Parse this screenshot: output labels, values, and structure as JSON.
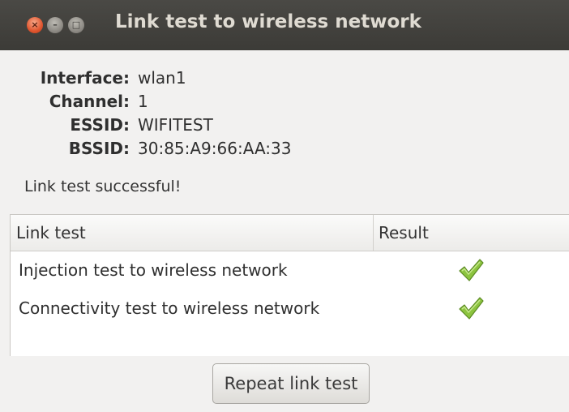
{
  "window": {
    "title": "Link test to wireless network",
    "buttons": {
      "close": "×",
      "minimize": "–",
      "maximize": "□"
    }
  },
  "info": {
    "rows": [
      {
        "label": "Interface:",
        "value": "wlan1"
      },
      {
        "label": "Channel:",
        "value": "1"
      },
      {
        "label": "ESSID:",
        "value": "WIFITEST"
      },
      {
        "label": "BSSID:",
        "value": "30:85:A9:66:AA:33"
      }
    ]
  },
  "status": "Link test successful!",
  "table": {
    "headers": [
      "Link test",
      "Result"
    ],
    "rows": [
      {
        "test": "Injection test to wireless network",
        "result_icon": "checkmark-icon"
      },
      {
        "test": "Connectivity test to wireless network",
        "result_icon": "checkmark-icon"
      }
    ]
  },
  "actions": {
    "repeat_label": "Repeat link test"
  },
  "colors": {
    "titlebar": "#3c3b37",
    "close": "#e0552e",
    "check": "#7fb93a"
  }
}
